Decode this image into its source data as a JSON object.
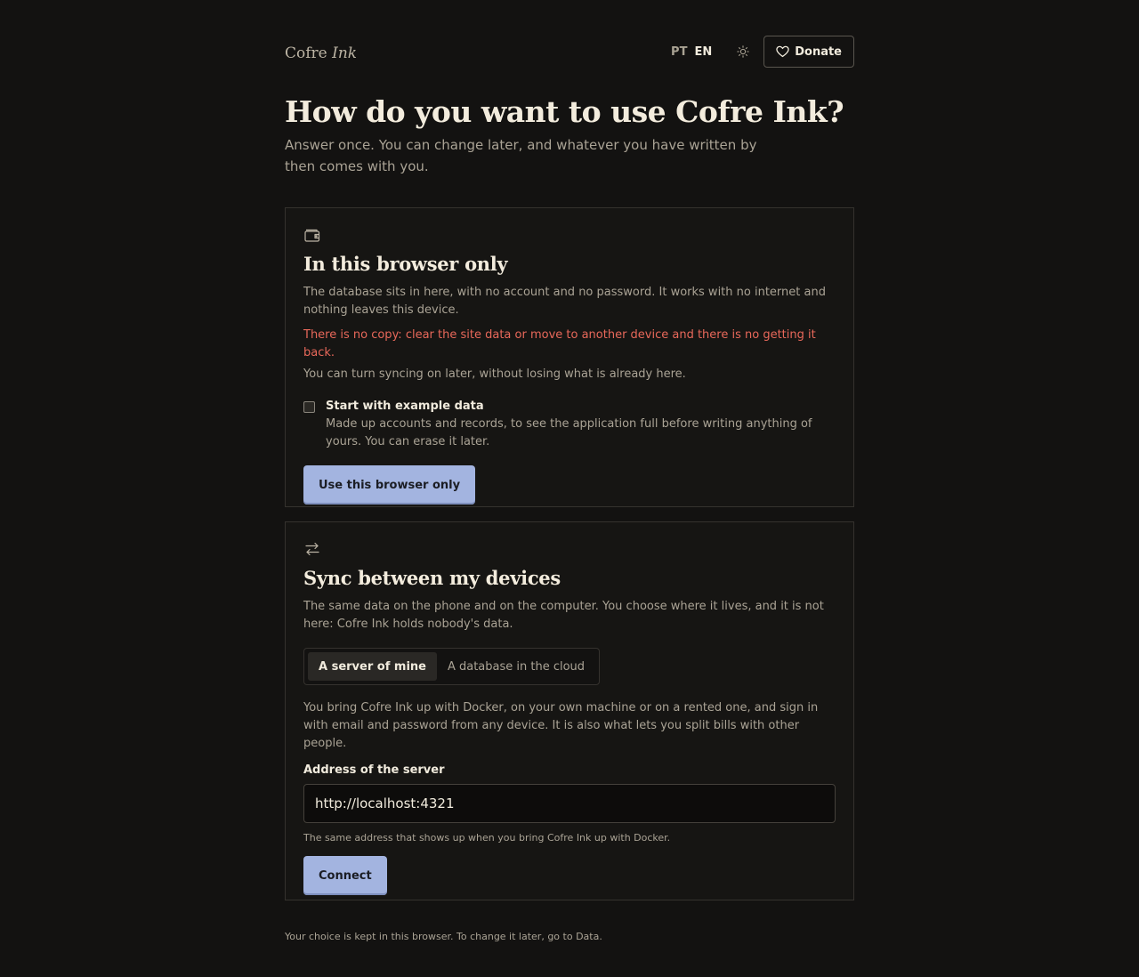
{
  "header": {
    "brand_main": "Cofre",
    "brand_italic": "Ink",
    "lang_pt": "PT",
    "lang_en": "EN",
    "donate_label": "Donate"
  },
  "intro": {
    "title": "How do you want to use Cofre Ink?",
    "subtitle": "Answer once. You can change later, and whatever you have written by then comes with you."
  },
  "local_card": {
    "icon": "wallet-icon",
    "title": "In this browser only",
    "description": "The database sits in here, with no account and no password. It works with no internet and nothing leaves this device.",
    "warning": "There is no copy: clear the site data or move to another device and there is no getting it back.",
    "note": "You can turn syncing on later, without losing what is already here.",
    "example_checkbox": {
      "label": "Start with example data",
      "description": "Made up accounts and records, to see the application full before writing anything of yours. You can erase it later.",
      "checked": false
    },
    "button_label": "Use this browser only"
  },
  "sync_card": {
    "icon": "arrows-exchange-icon",
    "title": "Sync between my devices",
    "description": "The same data on the phone and on the computer. You choose where it lives, and it is not here: Cofre Ink holds nobody's data.",
    "tabs": [
      {
        "label": "A server of mine",
        "active": true
      },
      {
        "label": "A database in the cloud",
        "active": false
      }
    ],
    "tab_description": "You bring Cofre Ink up with Docker, on your own machine or on a rented one, and sign in with email and password from any device. It is also what lets you split bills with other people.",
    "field_label": "Address of the server",
    "field_value": "http://localhost:4321",
    "hint": "The same address that shows up when you bring Cofre Ink up with Docker.",
    "button_label": "Connect"
  },
  "footer": {
    "text": "Your choice is kept in this browser. To change it later, go to Data."
  },
  "colors": {
    "background": "#131211",
    "accent": "#a3b4e0",
    "warning": "#e8685a"
  }
}
